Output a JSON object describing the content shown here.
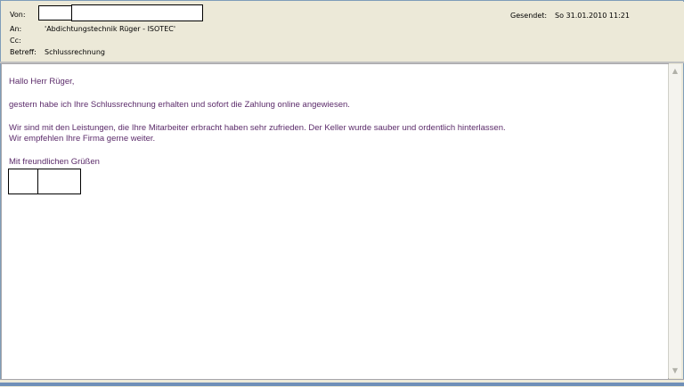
{
  "header": {
    "from_label": "Von:",
    "to_label": "An:",
    "to_value": "'Abdichtungstechnik Rüger - ISOTEC'",
    "cc_label": "Cc:",
    "subject_label": "Betreff:",
    "subject_value": "Schlussrechnung",
    "sent_label": "Gesendet:",
    "sent_value": "So 31.01.2010 11:21"
  },
  "message": {
    "greeting": "Hallo Herr Rüger,",
    "p1": "gestern habe ich Ihre Schlussrechnung erhalten und sofort die Zahlung online angewiesen.",
    "p2a": "Wir sind mit den Leistungen, die Ihre Mitarbeiter erbracht haben sehr zufrieden. Der Keller wurde sauber und ordentlich hinterlassen.",
    "p2b": "Wir empfehlen Ihre Firma gerne weiter.",
    "closing": "Mit freundlichen Grüßen"
  },
  "scrollbar": {
    "up": "▲",
    "down": "▼"
  }
}
